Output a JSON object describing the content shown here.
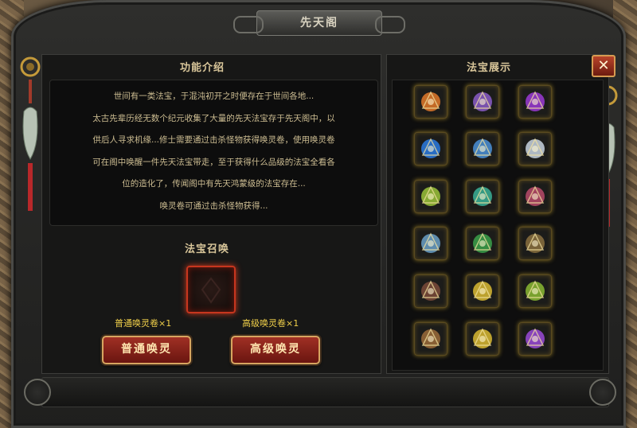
{
  "window": {
    "title": "先天阁"
  },
  "intro": {
    "heading": "功能介绍",
    "lines": [
      "世间有一类法宝，于混沌初开之时便存在于世间各地...",
      "太古先辈历经无数个纪元收集了大量的先天法宝存于先天阁中，以",
      "供后人寻求机缘...修士需要通过击杀怪物获得唤灵卷，使用唤灵卷",
      "可在阁中唤醒一件先天法宝带走，至于获得什么品级的法宝全看各",
      "位的造化了，传闻阁中有先天鸿蒙级的法宝存在...",
      "唤灵卷可通过击杀怪物获得..."
    ]
  },
  "summon": {
    "heading": "法宝召唤",
    "normal_scroll_label": "普通唤灵卷×1",
    "advanced_scroll_label": "高级唤灵卷×1",
    "normal_button": "普通唤灵",
    "advanced_button": "高级唤灵"
  },
  "showcase": {
    "heading": "法宝展示",
    "items": [
      {
        "icon": "taiji-orb-icon",
        "color": "#e0782a"
      },
      {
        "icon": "purple-wings-icon",
        "color": "#8a5cc8"
      },
      {
        "icon": "purple-orb-icon",
        "color": "#9b3ad6"
      },
      {
        "icon": "blue-vortex-icon",
        "color": "#2a7ae0"
      },
      {
        "icon": "lightning-claws-icon",
        "color": "#4a90d8"
      },
      {
        "icon": "white-flame-icon",
        "color": "#c8d4e0"
      },
      {
        "icon": "jade-sword-icon",
        "color": "#9ac23a"
      },
      {
        "icon": "serpent-whip-icon",
        "color": "#3ab098"
      },
      {
        "icon": "flame-bow-icon",
        "color": "#b84a6a"
      },
      {
        "icon": "spiked-wheel-icon",
        "color": "#6aa0c8"
      },
      {
        "icon": "jade-dragon-icon",
        "color": "#3aa04a"
      },
      {
        "icon": "bronze-gauntlets-icon",
        "color": "#8a7040"
      },
      {
        "icon": "dark-bow-icon",
        "color": "#7a4a3a"
      },
      {
        "icon": "gold-talisman-icon",
        "color": "#d8b832"
      },
      {
        "icon": "gem-cluster-icon",
        "color": "#8ab832"
      },
      {
        "icon": "wooden-bow-icon",
        "color": "#9a6a3a"
      },
      {
        "icon": "gold-talisman-icon",
        "color": "#d8b832"
      },
      {
        "icon": "purple-talisman-icon",
        "color": "#9a4ad8"
      }
    ]
  },
  "close_label": "✕"
}
